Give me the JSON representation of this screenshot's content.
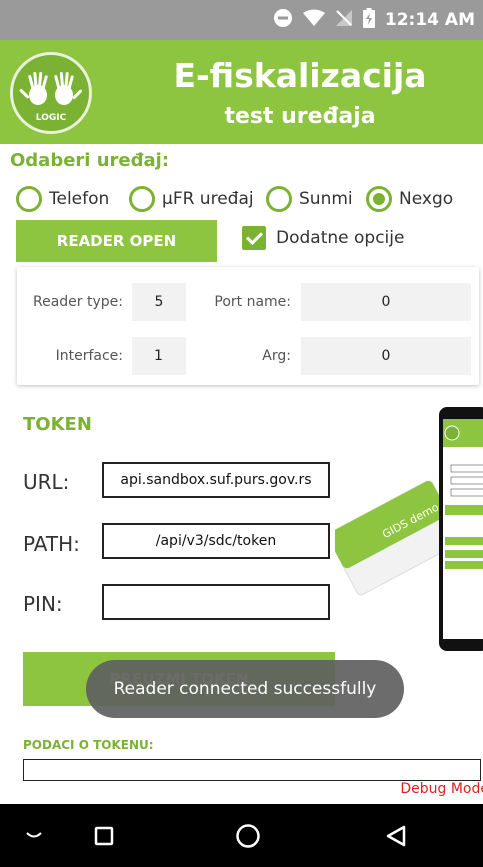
{
  "status_bar": {
    "time": "12:14 AM"
  },
  "header": {
    "title": "E-fiskalizacija",
    "subtitle": "test uređaja",
    "logo_text": "LOGIC"
  },
  "device_section": {
    "label": "Odaberi uređaj:",
    "options": [
      {
        "label": "Telefon",
        "selected": false
      },
      {
        "label": "µFR uređaj",
        "selected": false
      },
      {
        "label": "Sunmi",
        "selected": false
      },
      {
        "label": "Nexgo",
        "selected": true
      }
    ],
    "reader_button": "READER OPEN",
    "extra_options_label": "Dodatne opcije",
    "extra_options_checked": true
  },
  "reader_config": {
    "reader_type_label": "Reader type:",
    "reader_type_value": "5",
    "port_name_label": "Port name:",
    "port_name_value": "0",
    "interface_label": "Interface:",
    "interface_value": "1",
    "arg_label": "Arg:",
    "arg_value": "0"
  },
  "token_section": {
    "label": "TOKEN",
    "url_label": "URL:",
    "url_value": "api.sandbox.suf.purs.gov.rs",
    "path_label": "PATH:",
    "path_value": "/api/v3/sdc/token",
    "pin_label": "PIN:",
    "pin_value": "",
    "get_token_button": "PREUZMI TOKEN"
  },
  "promo": {
    "card_text": "GIDS demo"
  },
  "toast": "Reader connected successfully",
  "token_data_label": "PODACI O TOKENU:",
  "debug_label": "Debug Mode",
  "colors": {
    "accent": "#8dc540",
    "accent_dark": "#7cb233",
    "debug": "#e02020"
  }
}
